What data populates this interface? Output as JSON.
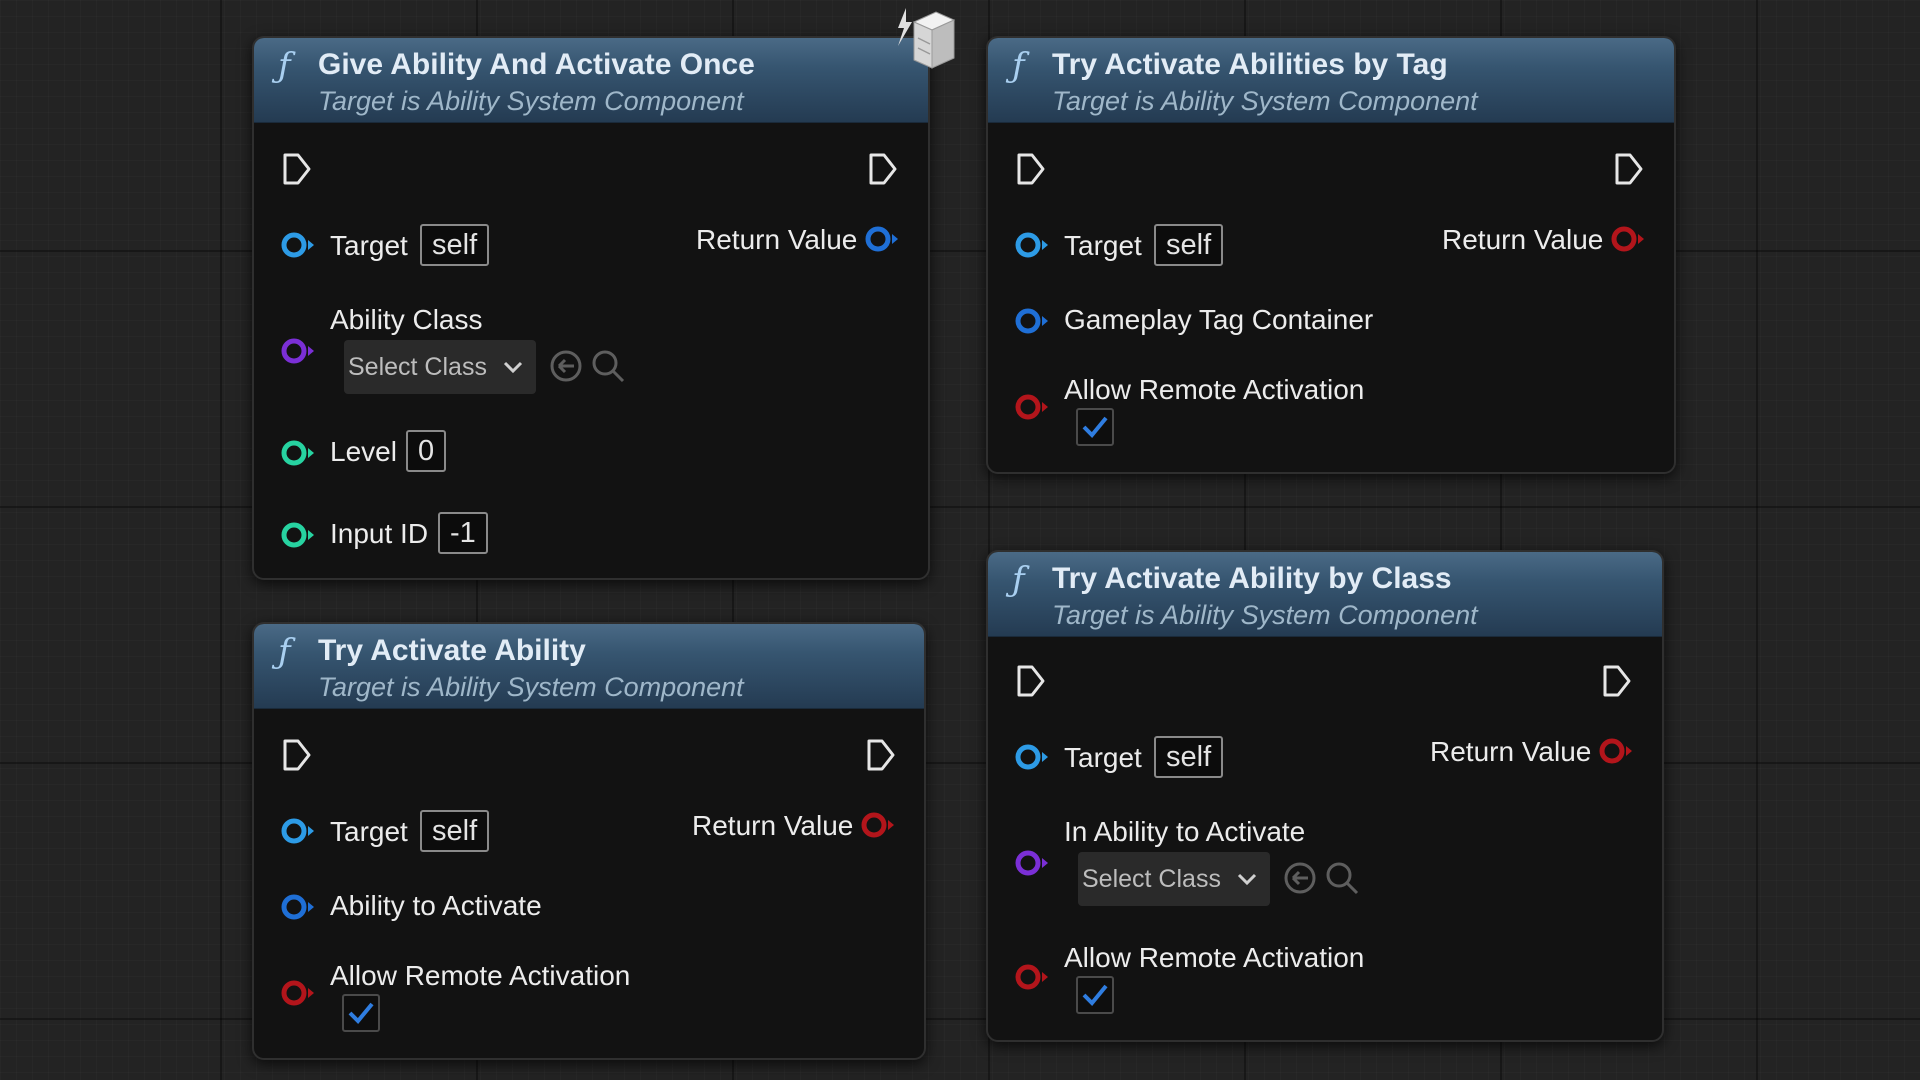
{
  "nodes": {
    "give_ability": {
      "title": "Give Ability And Activate Once",
      "subtitle": "Target is Ability System Component",
      "target_label": "Target",
      "target_value": "self",
      "return_label": "Return Value",
      "ability_class_label": "Ability Class",
      "select_class": "Select Class",
      "level_label": "Level",
      "level_value": "0",
      "input_id_label": "Input ID",
      "input_id_value": "-1"
    },
    "try_abilities_by_tag": {
      "title": "Try Activate Abilities by Tag",
      "subtitle": "Target is Ability System Component",
      "target_label": "Target",
      "target_value": "self",
      "return_label": "Return Value",
      "tag_container_label": "Gameplay Tag Container",
      "allow_remote_label": "Allow Remote Activation",
      "allow_remote_checked": true
    },
    "try_ability": {
      "title": "Try Activate Ability",
      "subtitle": "Target is Ability System Component",
      "target_label": "Target",
      "target_value": "self",
      "return_label": "Return Value",
      "ability_to_activate_label": "Ability to Activate",
      "allow_remote_label": "Allow Remote Activation",
      "allow_remote_checked": true
    },
    "try_ability_by_class": {
      "title": "Try Activate Ability by Class",
      "subtitle": "Target is Ability System Component",
      "target_label": "Target",
      "target_value": "self",
      "return_label": "Return Value",
      "in_ability_label": "In Ability to Activate",
      "select_class": "Select Class",
      "allow_remote_label": "Allow Remote Activation",
      "allow_remote_checked": true
    }
  },
  "colors": {
    "object_pin": "#2d9be6",
    "struct_pin": "#1f6fd6",
    "class_pin": "#7b2fd6",
    "int_pin": "#27d3a1",
    "bool_pin": "#b3151b",
    "check": "#2f7de0"
  },
  "icons": [
    "function-icon",
    "exec-pin-icon",
    "object-pin-icon",
    "dropdown-chevron-icon",
    "use-selected-icon",
    "browse-icon",
    "checkmark-icon",
    "cube-icon"
  ]
}
